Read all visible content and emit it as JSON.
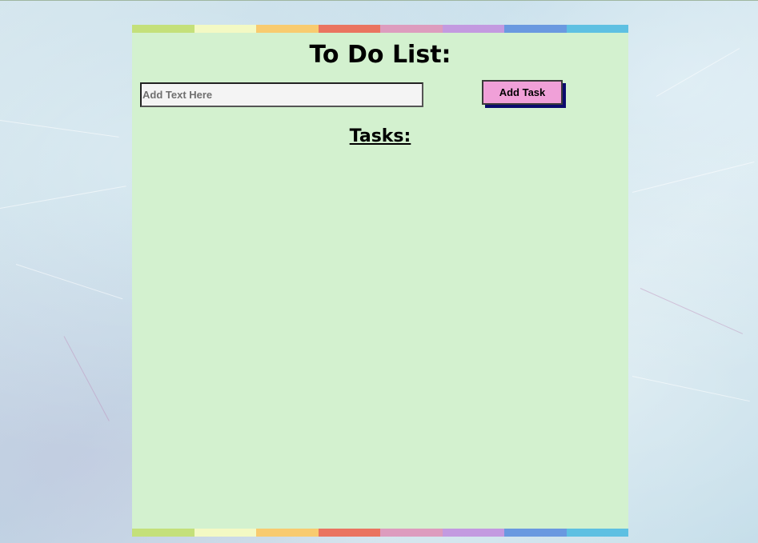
{
  "app": {
    "title": "To Do List:"
  },
  "form": {
    "input_value": "",
    "input_placeholder": "Add Text Here",
    "add_button_label": "Add Task"
  },
  "tasks": {
    "heading": "Tasks:",
    "items": []
  },
  "colors": {
    "background": "#c3dce8",
    "card": "#d3f1cf",
    "button": "#f0a0d8",
    "button_shadow": "#0b0b6e",
    "stripe": [
      "#c4e07a",
      "#f3f9c4",
      "#f8cb6f",
      "#ea7460",
      "#dd9cbe",
      "#c39ae0",
      "#6a99e0",
      "#5ec0e2"
    ]
  }
}
